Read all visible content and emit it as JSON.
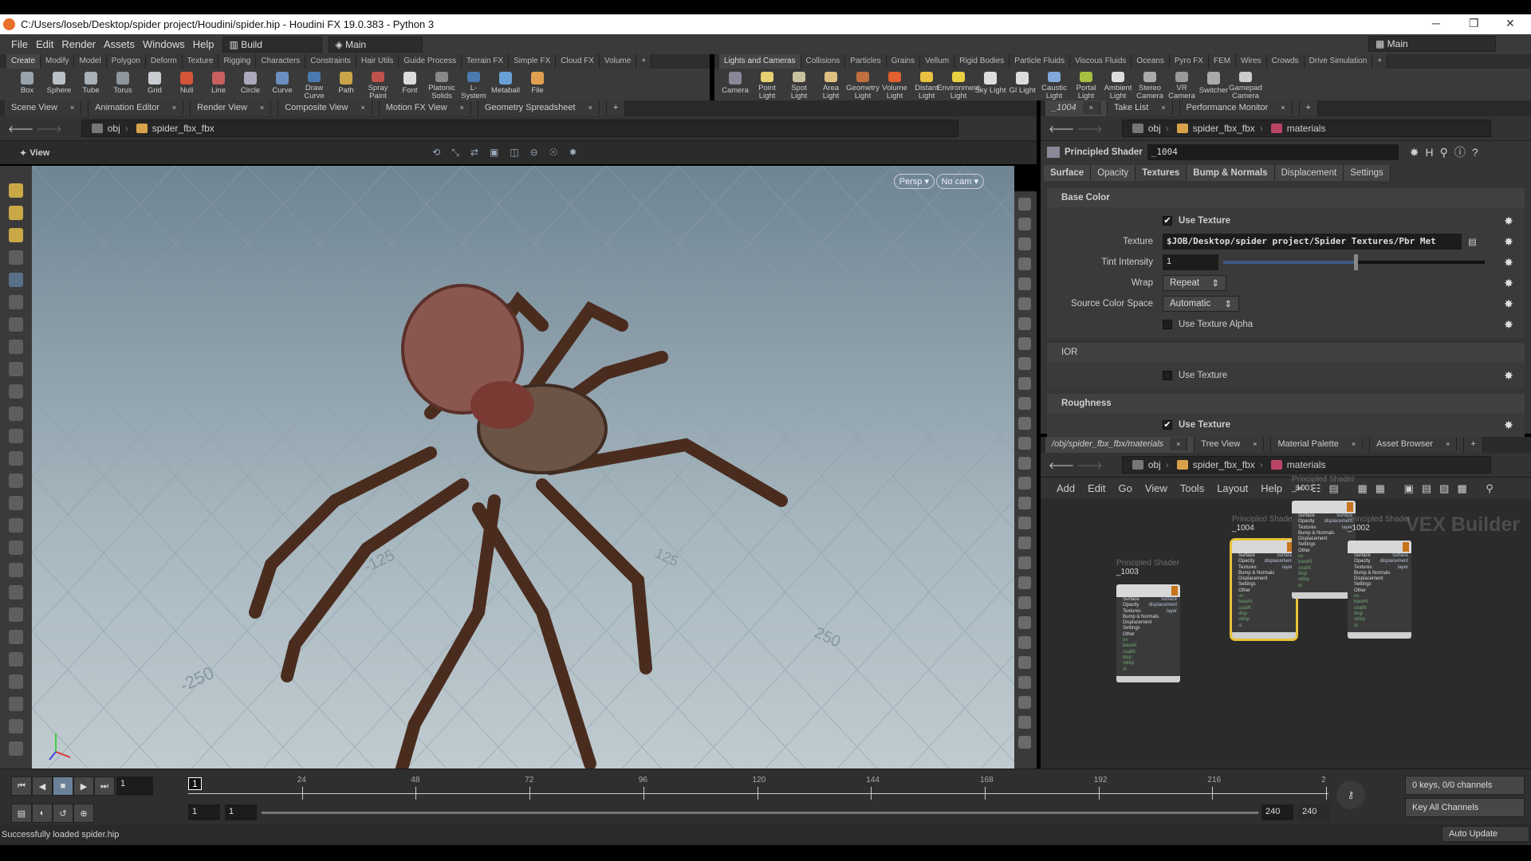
{
  "window": {
    "title": "C:/Users/loseb/Desktop/spider project/Houdini/spider.hip - Houdini FX 19.0.383 - Python 3",
    "minimize": "─",
    "maximize": "❐",
    "close": "✕"
  },
  "menu": {
    "items": [
      "File",
      "Edit",
      "Render",
      "Assets",
      "Windows",
      "Help"
    ],
    "desktop": "Build",
    "pane_layout": "Main",
    "right_desktop": "Main"
  },
  "shelf_left": {
    "tabs": [
      "Create",
      "Modify",
      "Model",
      "Polygon",
      "Deform",
      "Texture",
      "Rigging",
      "Characters",
      "Constraints",
      "Hair Utils",
      "Guide Process",
      "Terrain FX",
      "Simple FX",
      "Cloud FX",
      "Volume"
    ],
    "tools": [
      "Box",
      "Sphere",
      "Tube",
      "Torus",
      "Grid",
      "Null",
      "Line",
      "Circle",
      "Curve",
      "Draw Curve",
      "Path",
      "Spray Paint",
      "Font",
      "Platonic Solids",
      "L-System",
      "Metaball",
      "File"
    ]
  },
  "shelf_right": {
    "tabs": [
      "Lights and Cameras",
      "Collisions",
      "Particles",
      "Grains",
      "Vellum",
      "Rigid Bodies",
      "Particle Fluids",
      "Viscous Fluids",
      "Oceans",
      "Pyro FX",
      "FEM",
      "Wires",
      "Crowds",
      "Drive Simulation"
    ],
    "tools": [
      "Camera",
      "Point Light",
      "Spot Light",
      "Area Light",
      "Geometry Light",
      "Volume Light",
      "Distant Light",
      "Environment Light",
      "Sky Light",
      "GI Light",
      "Caustic Light",
      "Portal Light",
      "Ambient Light",
      "Stereo Camera",
      "VR Camera",
      "Switcher",
      "Gamepad Camera"
    ]
  },
  "left_pane": {
    "tabs": [
      "Scene View",
      "Animation Editor",
      "Render View",
      "Composite View",
      "Motion FX View",
      "Geometry Spreadsheet"
    ],
    "path": [
      "obj",
      "spider_fbx_fbx"
    ],
    "view_label": "View",
    "persp": "Persp ▾",
    "cam": "No cam ▾",
    "grid_labels": [
      "-125",
      "125",
      "250",
      "-250"
    ]
  },
  "param_pane": {
    "tabs": [
      "_1004",
      "Take List",
      "Performance Monitor"
    ],
    "path": [
      "obj",
      "spider_fbx_fbx",
      "materials"
    ],
    "node_type": "Principled Shader",
    "node_name": "_1004",
    "param_tabs": [
      "Surface",
      "Opacity",
      "Textures",
      "Bump & Normals",
      "Displacement",
      "Settings"
    ],
    "base_color": {
      "title": "Base Color",
      "use_texture": "Use Texture",
      "texture_label": "Texture",
      "texture_value": "$JOB/Desktop/spider project/Spider Textures/Pbr Met",
      "tint_label": "Tint Intensity",
      "tint_value": "1",
      "tint_fraction": 0.5,
      "wrap_label": "Wrap",
      "wrap_value": "Repeat",
      "csp_label": "Source Color Space",
      "csp_value": "Automatic",
      "alpha_label": "Use Texture Alpha"
    },
    "ior": {
      "title": "IOR",
      "use_texture": "Use Texture"
    },
    "roughness": {
      "title": "Roughness",
      "use_texture": "Use Texture"
    }
  },
  "network_pane": {
    "tabs": [
      "/obj/spider_fbx_fbx/materials",
      "Tree View",
      "Material Palette",
      "Asset Browser"
    ],
    "path": [
      "obj",
      "spider_fbx_fbx",
      "materials"
    ],
    "menu": [
      "Add",
      "Edit",
      "Go",
      "View",
      "Tools",
      "Layout",
      "Help"
    ],
    "context": "VEX Builder",
    "nodes": [
      {
        "type": "Principled Shader",
        "name": "_1003"
      },
      {
        "type": "Principled Shader",
        "name": "_1004"
      },
      {
        "type": "Principled Shader",
        "name": "_1001"
      },
      {
        "type": "Principled Shader",
        "name": "_1002"
      }
    ],
    "node_inputs": [
      "Surface",
      "Opacity",
      "Textures",
      "Bump & Normals",
      "Displacement",
      "Settings",
      "Other",
      "uv",
      "baseN",
      "coatN",
      "disp",
      "vdisp",
      "st"
    ],
    "node_outputs": [
      "surface",
      "displacement",
      "layer"
    ]
  },
  "timeline": {
    "current_frame": "1",
    "ticks": [
      "24",
      "48",
      "72",
      "96",
      "120",
      "144",
      "168",
      "192",
      "216",
      "2"
    ],
    "start": "1",
    "start2": "1",
    "end": "240",
    "end2": "240",
    "keys": "0 keys, 0/0 channels",
    "key_mode": "Key All Channels"
  },
  "status": {
    "message": "Successfully loaded spider.hip",
    "update": "Auto Update"
  }
}
